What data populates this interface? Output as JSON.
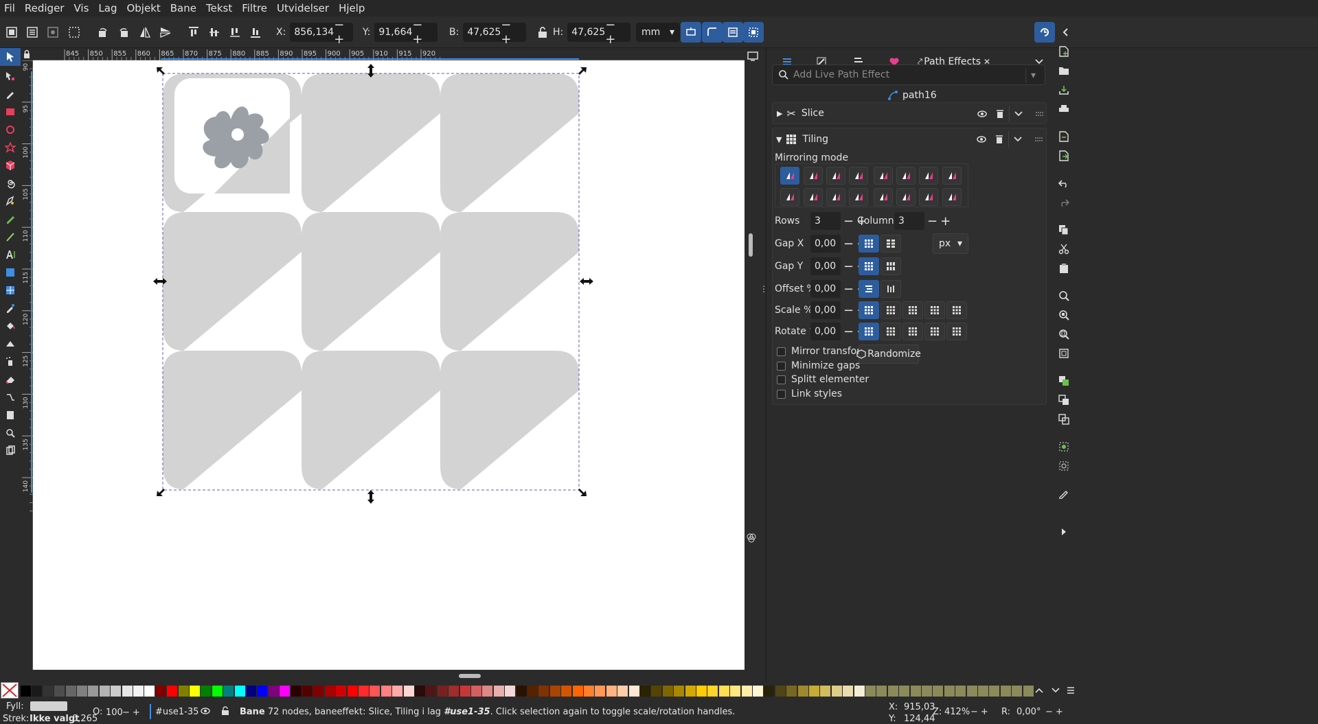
{
  "menu": [
    "Fil",
    "Rediger",
    "Vis",
    "Lag",
    "Objekt",
    "Bane",
    "Tekst",
    "Filtre",
    "Utvidelser",
    "Hjelp"
  ],
  "toolbar": {
    "x_label": "X:",
    "x_value": "856,134",
    "y_label": "Y:",
    "y_value": "91,664",
    "w_label": "B:",
    "w_value": "47,625",
    "h_label": "H:",
    "h_value": "47,625",
    "unit": "mm"
  },
  "ruler_h": [
    "845",
    "850",
    "855",
    "860",
    "865",
    "870",
    "875",
    "880",
    "885",
    "890",
    "895",
    "900",
    "905",
    "910",
    "915",
    "920"
  ],
  "ruler_v": [
    "90",
    "95",
    "100",
    "105",
    "110",
    "115",
    "120",
    "125",
    "130",
    "135",
    "140"
  ],
  "panel": {
    "tab_label": "Path Effects",
    "search_placeholder": "Add Live Path Effect",
    "object_name": "path16",
    "effects": [
      {
        "name": "Slice"
      },
      {
        "name": "Tiling"
      }
    ],
    "mirroring_label": "Mirroring mode",
    "rows_label": "Rows",
    "rows_value": "3",
    "columns_label": "Columns",
    "columns_value": "3",
    "gapx_label": "Gap X",
    "gapx_value": "0,00",
    "gapy_label": "Gap Y",
    "gapy_value": "0,00",
    "offset_label": "Offset %",
    "offset_value": "0,00",
    "scale_label": "Scale %",
    "scale_value": "0,00",
    "rotate_label": "Rotate °",
    "rotate_value": "0,00",
    "unit": "px",
    "randomize_label": "Randomize",
    "checkboxes": [
      "Mirror transforms",
      "Minimize gaps",
      "Splitt elementer",
      "Link styles"
    ]
  },
  "status": {
    "fill_label": "Fyll:",
    "stroke_label": "Strek:",
    "stroke_value": "Ikke valgt",
    "stroke_width": "0,265",
    "opacity_label": "O:",
    "opacity_value": "100",
    "layer": "#use1-35",
    "message_bold": "Bane",
    "message": " 72 nodes, baneeffekt: Slice, Tiling i lag ",
    "message_layer": "#use1-35",
    "message_end": ". Click selection again to toggle scale/rotation handles.",
    "cx_label": "X:",
    "cx_value": "915,03",
    "cy_label": "Y:",
    "cy_value": "124,44",
    "zoom_label": "Z:",
    "zoom_value": "412%",
    "rot_label": "R:",
    "rot_value": "0,00°"
  },
  "colors": {
    "accent": "#2e5d9e",
    "shape": "#d3d3d3",
    "gear": "#9aa0a6",
    "pink": "#e83e8c"
  }
}
